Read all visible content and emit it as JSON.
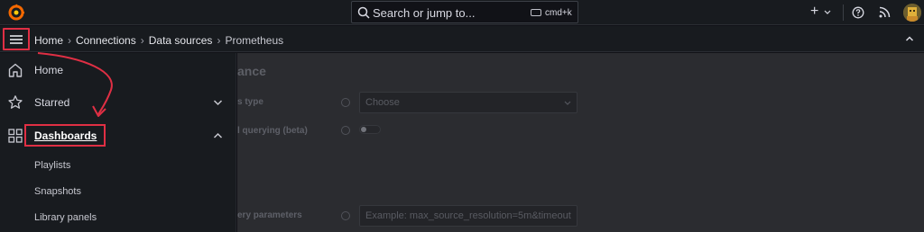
{
  "topbar": {
    "logo_icon": "grafana-logo-icon",
    "search_placeholder": "Search or jump to...",
    "search_shortcut": "cmd+k",
    "new_icon": "plus-icon",
    "help_icon": "help-icon",
    "news_icon": "rss-icon",
    "avatar_icon": "user-avatar"
  },
  "breadcrumbs": {
    "items": [
      "Home",
      "Connections",
      "Data sources"
    ],
    "current": "Prometheus"
  },
  "nav": {
    "items": [
      {
        "label": "Home",
        "icon": "home-icon"
      },
      {
        "label": "Starred",
        "icon": "star-icon"
      },
      {
        "label": "Dashboards",
        "icon": "apps-icon"
      }
    ],
    "sub_items": [
      "Playlists",
      "Snapshots",
      "Library panels"
    ]
  },
  "main": {
    "title": "ance",
    "fields": [
      {
        "label": "s type",
        "value": "Choose"
      },
      {
        "label": "l querying (beta)"
      },
      {
        "label": "ery parameters",
        "placeholder": "Example: max_source_resolution=5m&timeout"
      }
    ]
  },
  "colors": {
    "highlight": "#e02f44",
    "background": "#111217",
    "panel": "#181b1f"
  }
}
